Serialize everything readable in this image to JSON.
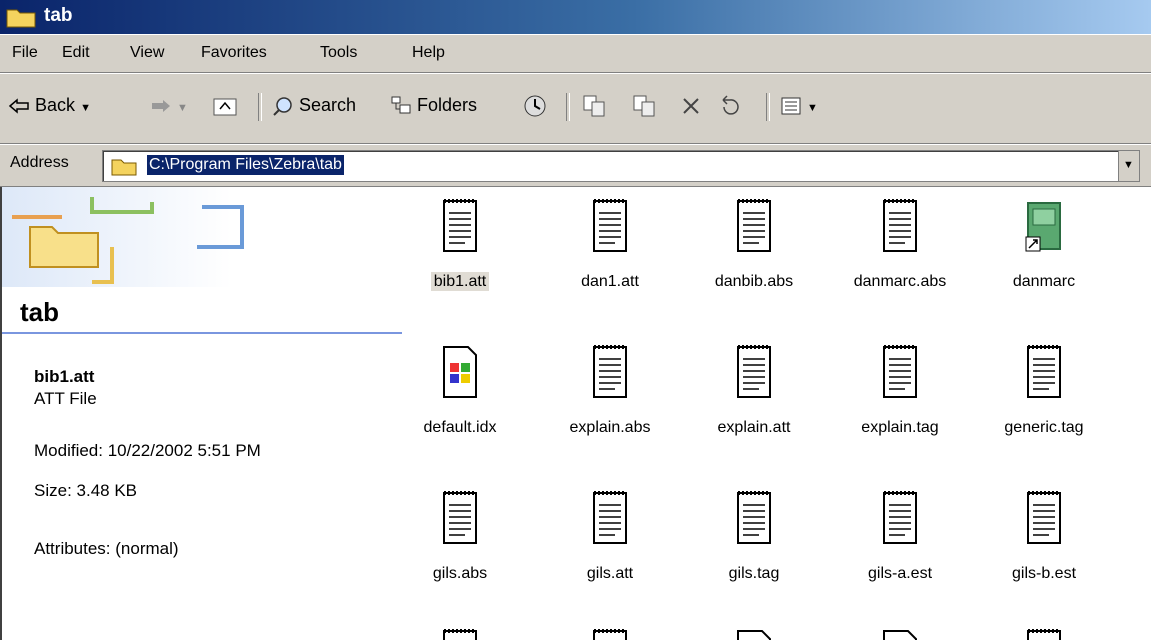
{
  "window": {
    "title": "tab"
  },
  "menu": [
    "File",
    "Edit",
    "View",
    "Favorites",
    "Tools",
    "Help"
  ],
  "toolbar": {
    "back": "Back",
    "search": "Search",
    "folders": "Folders"
  },
  "address": {
    "label": "Address",
    "value": "C:\\Program Files\\Zebra\\tab"
  },
  "leftpane": {
    "folder_name": "tab",
    "selected": {
      "name": "bib1.att",
      "type": "ATT File",
      "modified": "Modified: 10/22/2002 5:51 PM",
      "size": "Size: 3.48 KB",
      "attributes": "Attributes: (normal)"
    }
  },
  "files": [
    {
      "name": "bib1.att",
      "icon": "text-file-icon"
    },
    {
      "name": "dan1.att",
      "icon": "text-file-icon"
    },
    {
      "name": "danbib.abs",
      "icon": "text-file-icon"
    },
    {
      "name": "danmarc.abs",
      "icon": "text-file-icon"
    },
    {
      "name": "danmarc",
      "icon": "shortcut-icon"
    },
    {
      "name": "default.idx",
      "icon": "windows-file-icon"
    },
    {
      "name": "explain.abs",
      "icon": "text-file-icon"
    },
    {
      "name": "explain.att",
      "icon": "text-file-icon"
    },
    {
      "name": "explain.tag",
      "icon": "text-file-icon"
    },
    {
      "name": "generic.tag",
      "icon": "text-file-icon"
    },
    {
      "name": "gils.abs",
      "icon": "text-file-icon"
    },
    {
      "name": "gils.att",
      "icon": "text-file-icon"
    },
    {
      "name": "gils.tag",
      "icon": "text-file-icon"
    },
    {
      "name": "gils-a.est",
      "icon": "text-file-icon"
    },
    {
      "name": "gils-b.est",
      "icon": "text-file-icon"
    }
  ],
  "colors": {
    "titlebar": "#0a246a",
    "chrome": "#d4d0c8",
    "selection": "#0a246a"
  }
}
